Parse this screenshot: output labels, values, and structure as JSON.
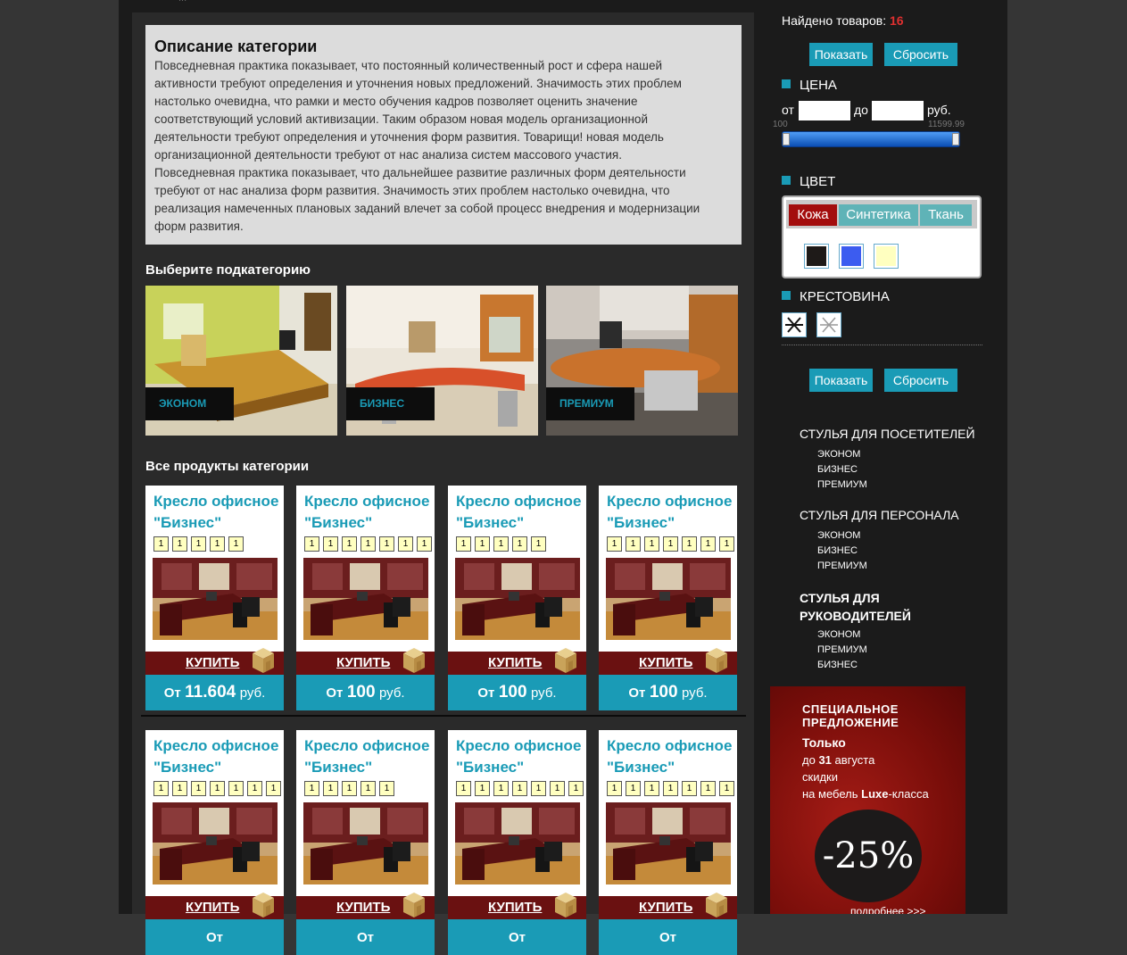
{
  "breadcrumb": "...",
  "description": {
    "title": "Описание категории",
    "lines": [
      "Повседневная практика показывает, что постоянный количественный рост и сфера нашей",
      "активности требуют определения и уточнения новых предложений. Значимость этих проблем",
      "настолько очевидна, что рамки и место обучения кадров позволяет оценить значение",
      "соответствующий условий активизации. Таким образом новая модель организационной",
      "деятельности требуют определения и уточнения форм развития. Товарищи! новая модель",
      "организационной деятельности требуют от нас анализа систем массового участия.",
      "Повседневная практика показывает, что дальнейшее развитие различных форм деятельности",
      "требуют от нас анализа форм развития. Значимость этих проблем настолько очевидна, что",
      "реализация намеченных плановых заданий влечет за собой процесс внедрения и модернизации",
      "форм развития."
    ]
  },
  "subcategories": {
    "title": "Выберите подкатегорию",
    "items": [
      {
        "label": "ЭКОНОМ",
        "image": "office-green-photo"
      },
      {
        "label": "БИЗНЕС",
        "image": "office-red-photo"
      },
      {
        "label": "ПРЕМИУМ",
        "image": "office-wood-photo"
      }
    ]
  },
  "products": {
    "title": "Все продукты категории",
    "items": [
      {
        "name": "Кресло офисное \"Бизнес\"",
        "stars": [
          "1",
          "1",
          "1",
          "1",
          "1"
        ],
        "buy": "КУПИТЬ",
        "price_prefix": "От",
        "price": "11.604",
        "currency": "руб."
      },
      {
        "name": "Кресло офисное \"Бизнес\"",
        "stars": [
          "1",
          "1",
          "1",
          "1",
          "1",
          "1",
          "1"
        ],
        "buy": "КУПИТЬ",
        "price_prefix": "От",
        "price": "100",
        "currency": "руб."
      },
      {
        "name": "Кресло офисное \"Бизнес\"",
        "stars": [
          "1",
          "1",
          "1",
          "1",
          "1"
        ],
        "buy": "КУПИТЬ",
        "price_prefix": "От",
        "price": "100",
        "currency": "руб."
      },
      {
        "name": "Кресло офисное \"Бизнес\"",
        "stars": [
          "1",
          "1",
          "1",
          "1",
          "1",
          "1",
          "1"
        ],
        "buy": "КУПИТЬ",
        "price_prefix": "От",
        "price": "100",
        "currency": "руб."
      },
      {
        "name": "Кресло офисное \"Бизнес\"",
        "stars": [
          "1",
          "1",
          "1",
          "1",
          "1",
          "1",
          "1"
        ],
        "buy": "КУПИТЬ",
        "price_prefix": "От",
        "price": "",
        "currency": ""
      },
      {
        "name": "Кресло офисное \"Бизнес\"",
        "stars": [
          "1",
          "1",
          "1",
          "1",
          "1"
        ],
        "buy": "КУПИТЬ",
        "price_prefix": "От",
        "price": "",
        "currency": ""
      },
      {
        "name": "Кресло офисное \"Бизнес\"",
        "stars": [
          "1",
          "1",
          "1",
          "1",
          "1",
          "1",
          "1"
        ],
        "buy": "КУПИТЬ",
        "price_prefix": "От",
        "price": "",
        "currency": ""
      },
      {
        "name": "Кресло офисное \"Бизнес\"",
        "stars": [
          "1",
          "1",
          "1",
          "1",
          "1",
          "1",
          "1"
        ],
        "buy": "КУПИТЬ",
        "price_prefix": "От",
        "price": "",
        "currency": ""
      }
    ]
  },
  "filter": {
    "found_label": "Найдено товаров:",
    "found_count": "16",
    "show_label": "Показать",
    "reset_label": "Сбросить",
    "price": {
      "title": "ЦЕНА",
      "from_label": "от",
      "to_label": "до",
      "currency": "руб.",
      "min": "100",
      "max": "11599.99",
      "from_value": "",
      "to_value": ""
    },
    "color": {
      "title": "ЦВЕТ",
      "tabs": [
        "Кожа",
        "Синтетика",
        "Ткань"
      ],
      "active_tab": "Кожа",
      "swatches": [
        "#1e1a18",
        "#3c5cf0",
        "#ffffc0"
      ]
    },
    "crosspiece": {
      "title": "КРЕСТОВИНА",
      "options": [
        "crosspiece-black-icon",
        "crosspiece-chrome-icon"
      ]
    }
  },
  "categories": [
    {
      "title": "СТУЛЬЯ ДЛЯ ПОСЕТИТЕЛЕЙ",
      "subs": [
        "ЭКОНОМ",
        "БИЗНЕС",
        "ПРЕМИУМ"
      ]
    },
    {
      "title": "СТУЛЬЯ ДЛЯ ПЕРСОНАЛА",
      "subs": [
        "ЭКОНОМ",
        "БИЗНЕС",
        "ПРЕМИУМ"
      ]
    },
    {
      "title_line1": "СТУЛЬЯ ДЛЯ",
      "title_line2": "РУКОВОДИТЕЛЕЙ",
      "subs": [
        "ЭКОНОМ",
        "ПРЕМИУМ",
        "БИЗНЕС"
      ]
    }
  ],
  "promo": {
    "line1": "СПЕЦИАЛЬНОЕ",
    "line2": "ПРЕДЛОЖЕНИЕ",
    "only": "Только",
    "until_pre": "до",
    "until_day": "31",
    "until_post": "августа",
    "discount_word": "скидки",
    "on_pre": "на мебель",
    "on_brand": "Luxe",
    "on_post": "-класса",
    "discount": "-25%",
    "more": "подробнее >>>"
  },
  "colors": {
    "accent": "#1a9bb6",
    "buy_bar": "#6a1111",
    "found_count": "#e03030",
    "active_tab": "#a30d0d"
  }
}
